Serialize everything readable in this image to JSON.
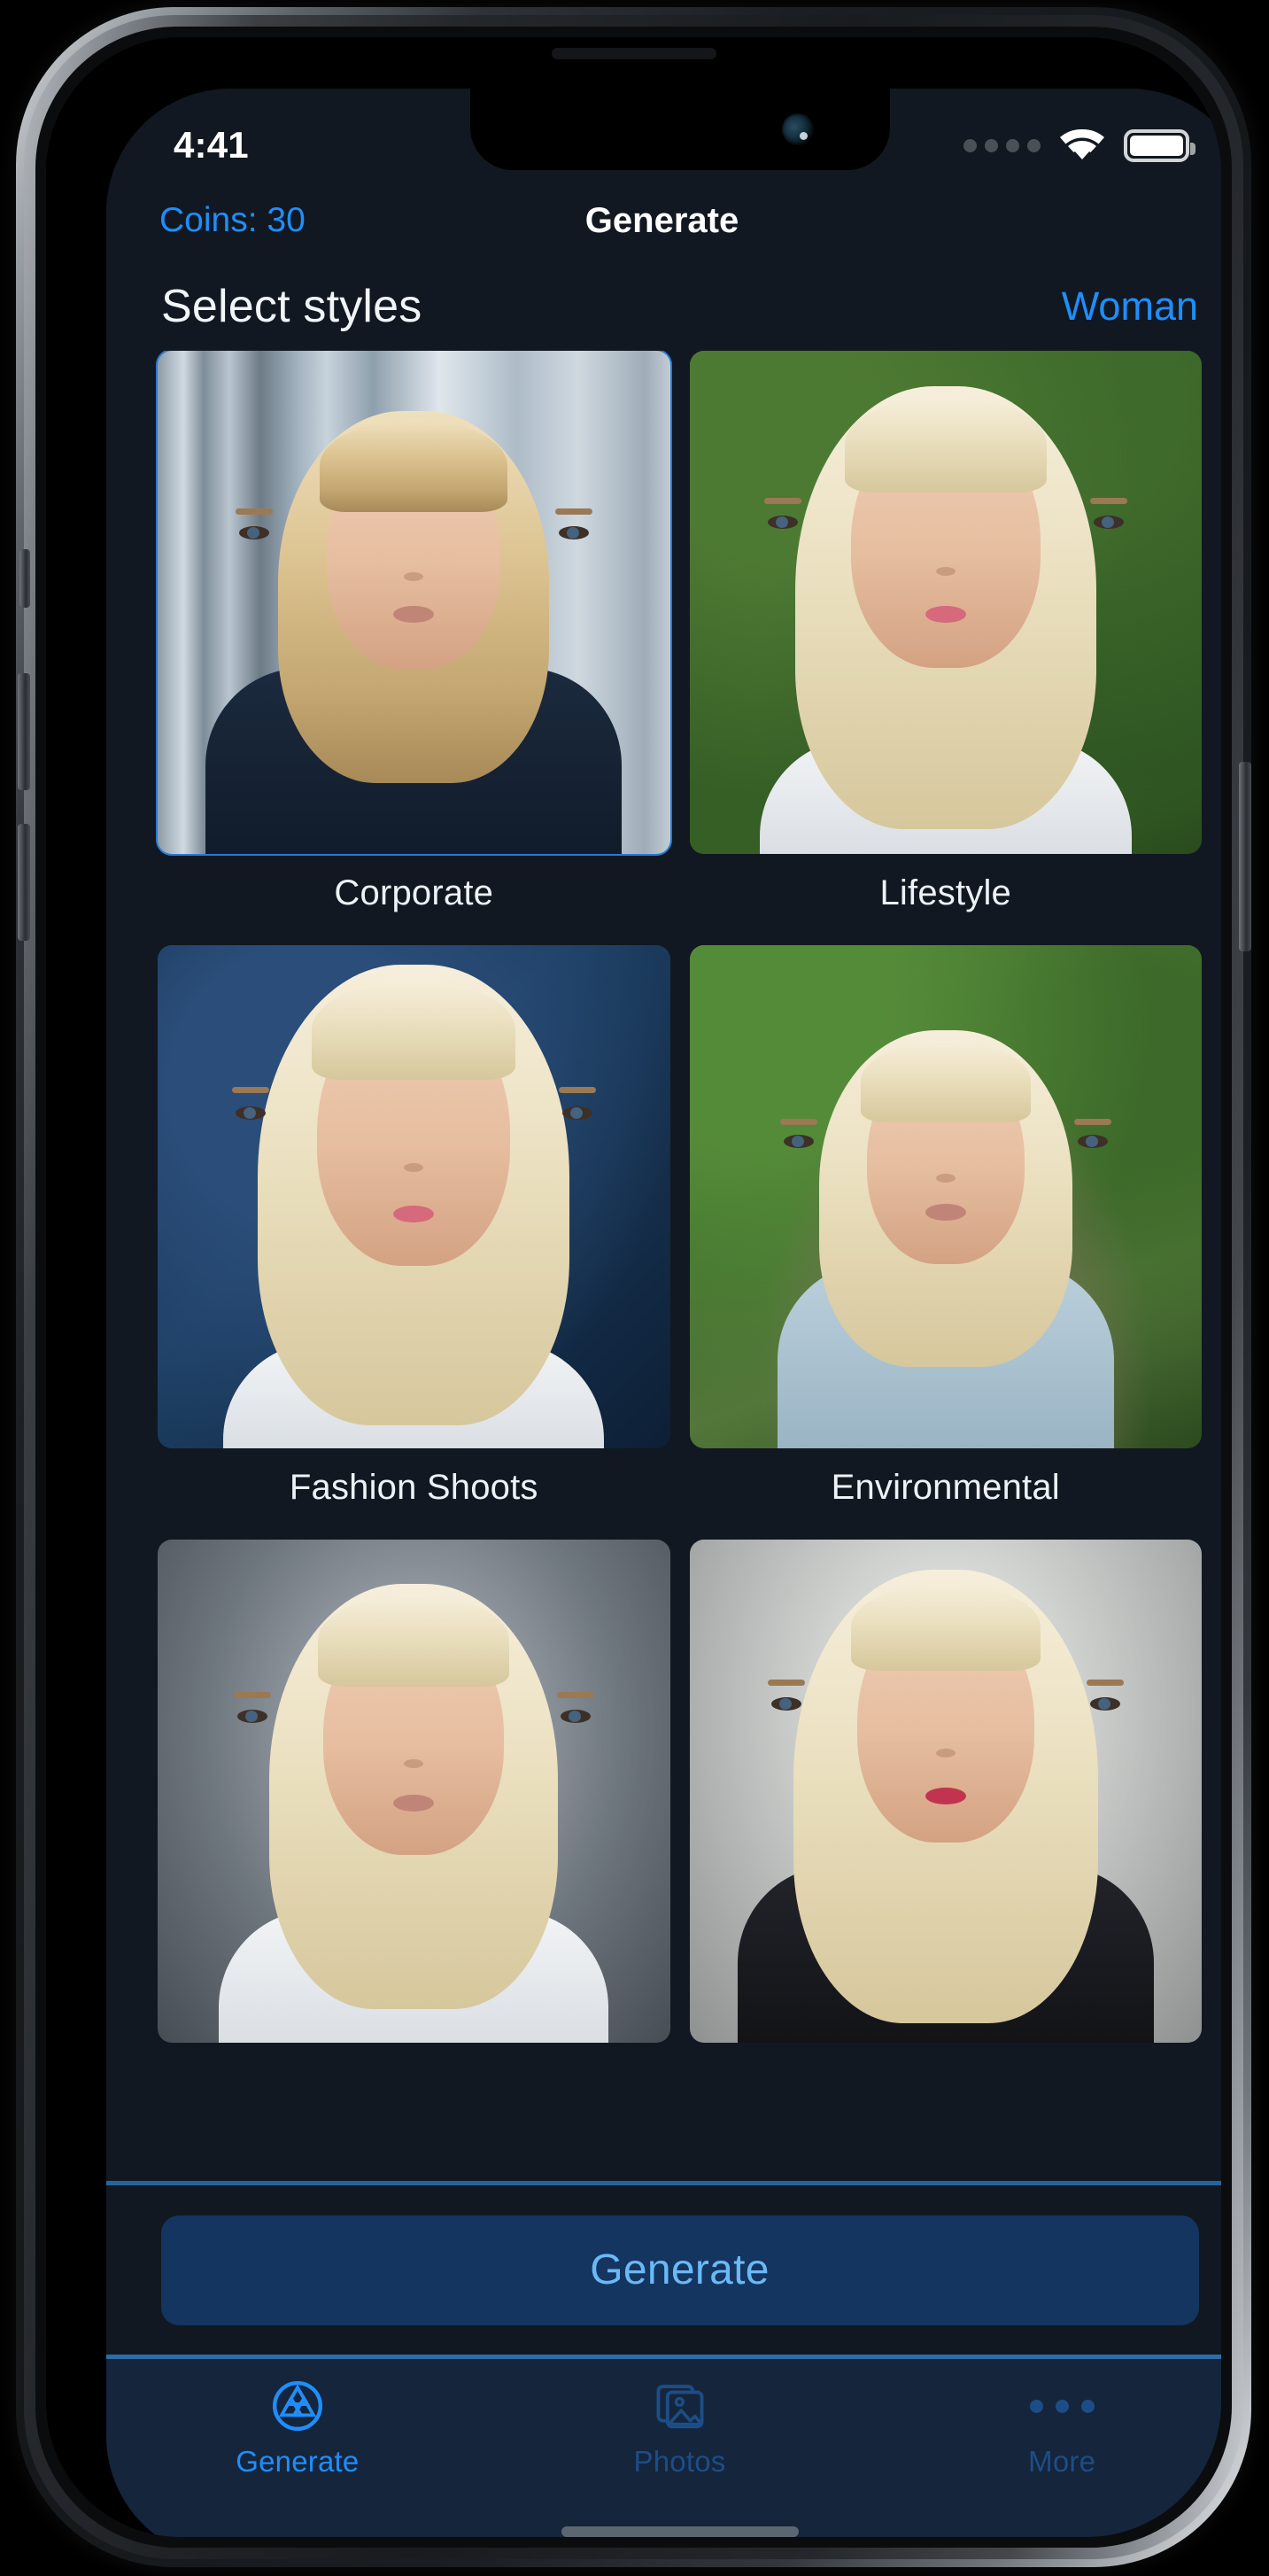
{
  "status_bar": {
    "time": "4:41",
    "signal_icon": "signal-dots-icon",
    "wifi_icon": "wifi-icon",
    "battery_icon": "battery-full-icon"
  },
  "nav_bar": {
    "coins_label": "Coins: 30",
    "title": "Generate"
  },
  "section": {
    "title": "Select styles",
    "gender_link": "Woman"
  },
  "styles": [
    {
      "label": "Corporate",
      "selected": true,
      "art": "corporate"
    },
    {
      "label": "Lifestyle",
      "selected": false,
      "art": "lifestyle"
    },
    {
      "label": "Fashion Shoots",
      "selected": false,
      "art": "fashion"
    },
    {
      "label": "Environmental",
      "selected": false,
      "art": "environmental"
    },
    {
      "label": "",
      "selected": false,
      "art": "studio-grey"
    },
    {
      "label": "",
      "selected": false,
      "art": "glamour"
    }
  ],
  "cta": {
    "label": "Generate"
  },
  "tab_bar": {
    "tabs": [
      {
        "label": "Generate",
        "icon": "aperture-icon",
        "active": true
      },
      {
        "label": "Photos",
        "icon": "photo-stack-icon",
        "active": false
      },
      {
        "label": "More",
        "icon": "ellipsis-icon",
        "active": false
      }
    ]
  },
  "colors": {
    "background": "#111821",
    "accent_blue": "#1f8efa",
    "cta_background": "#14355f",
    "cta_text": "#6ab9f7",
    "tabbar_background": "#15253c",
    "tab_inactive": "#1d4d86",
    "text_primary": "#f2f5f8"
  }
}
